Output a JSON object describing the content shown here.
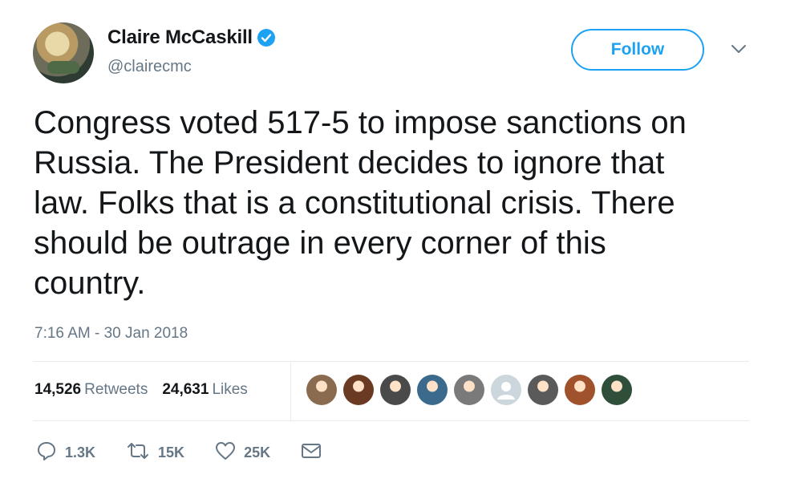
{
  "author": {
    "name": "Claire McCaskill",
    "handle": "@clairecmc",
    "avatar_icon": "profile-photo",
    "verified_icon": "verified-badge-icon"
  },
  "follow_button": {
    "label": "Follow"
  },
  "tweet": {
    "text": "Congress voted 517-5 to impose sanctions on\nRussia. The President decides to ignore that\nlaw. Folks that is a constitutional crisis. There\nshould be outrage in every corner of this\ncountry.",
    "timestamp": "7:16 AM - 30 Jan 2018"
  },
  "stats": {
    "retweets_count": "14,526",
    "retweets_label": "Retweets",
    "likes_count": "24,631",
    "likes_label": "Likes"
  },
  "likers": [
    {
      "name": "liker-avatar-1",
      "color": "#8a6b4f"
    },
    {
      "name": "liker-avatar-2",
      "color": "#6b3a22"
    },
    {
      "name": "liker-avatar-3",
      "color": "#4a4a4a"
    },
    {
      "name": "liker-avatar-4",
      "color": "#3b6a8c"
    },
    {
      "name": "liker-avatar-5",
      "color": "#7a7a7a"
    },
    {
      "name": "liker-avatar-default",
      "color": "#ccd6dd"
    },
    {
      "name": "liker-avatar-7",
      "color": "#5a5a5a"
    },
    {
      "name": "liker-avatar-8",
      "color": "#a0522d"
    },
    {
      "name": "liker-avatar-9",
      "color": "#2f4f3a"
    }
  ],
  "actions": {
    "reply_count": "1.3K",
    "retweet_count": "15K",
    "like_count": "25K"
  },
  "colors": {
    "accent": "#1da1f2",
    "muted": "#657786",
    "text": "#14171a",
    "divider": "#e6ecf0"
  }
}
